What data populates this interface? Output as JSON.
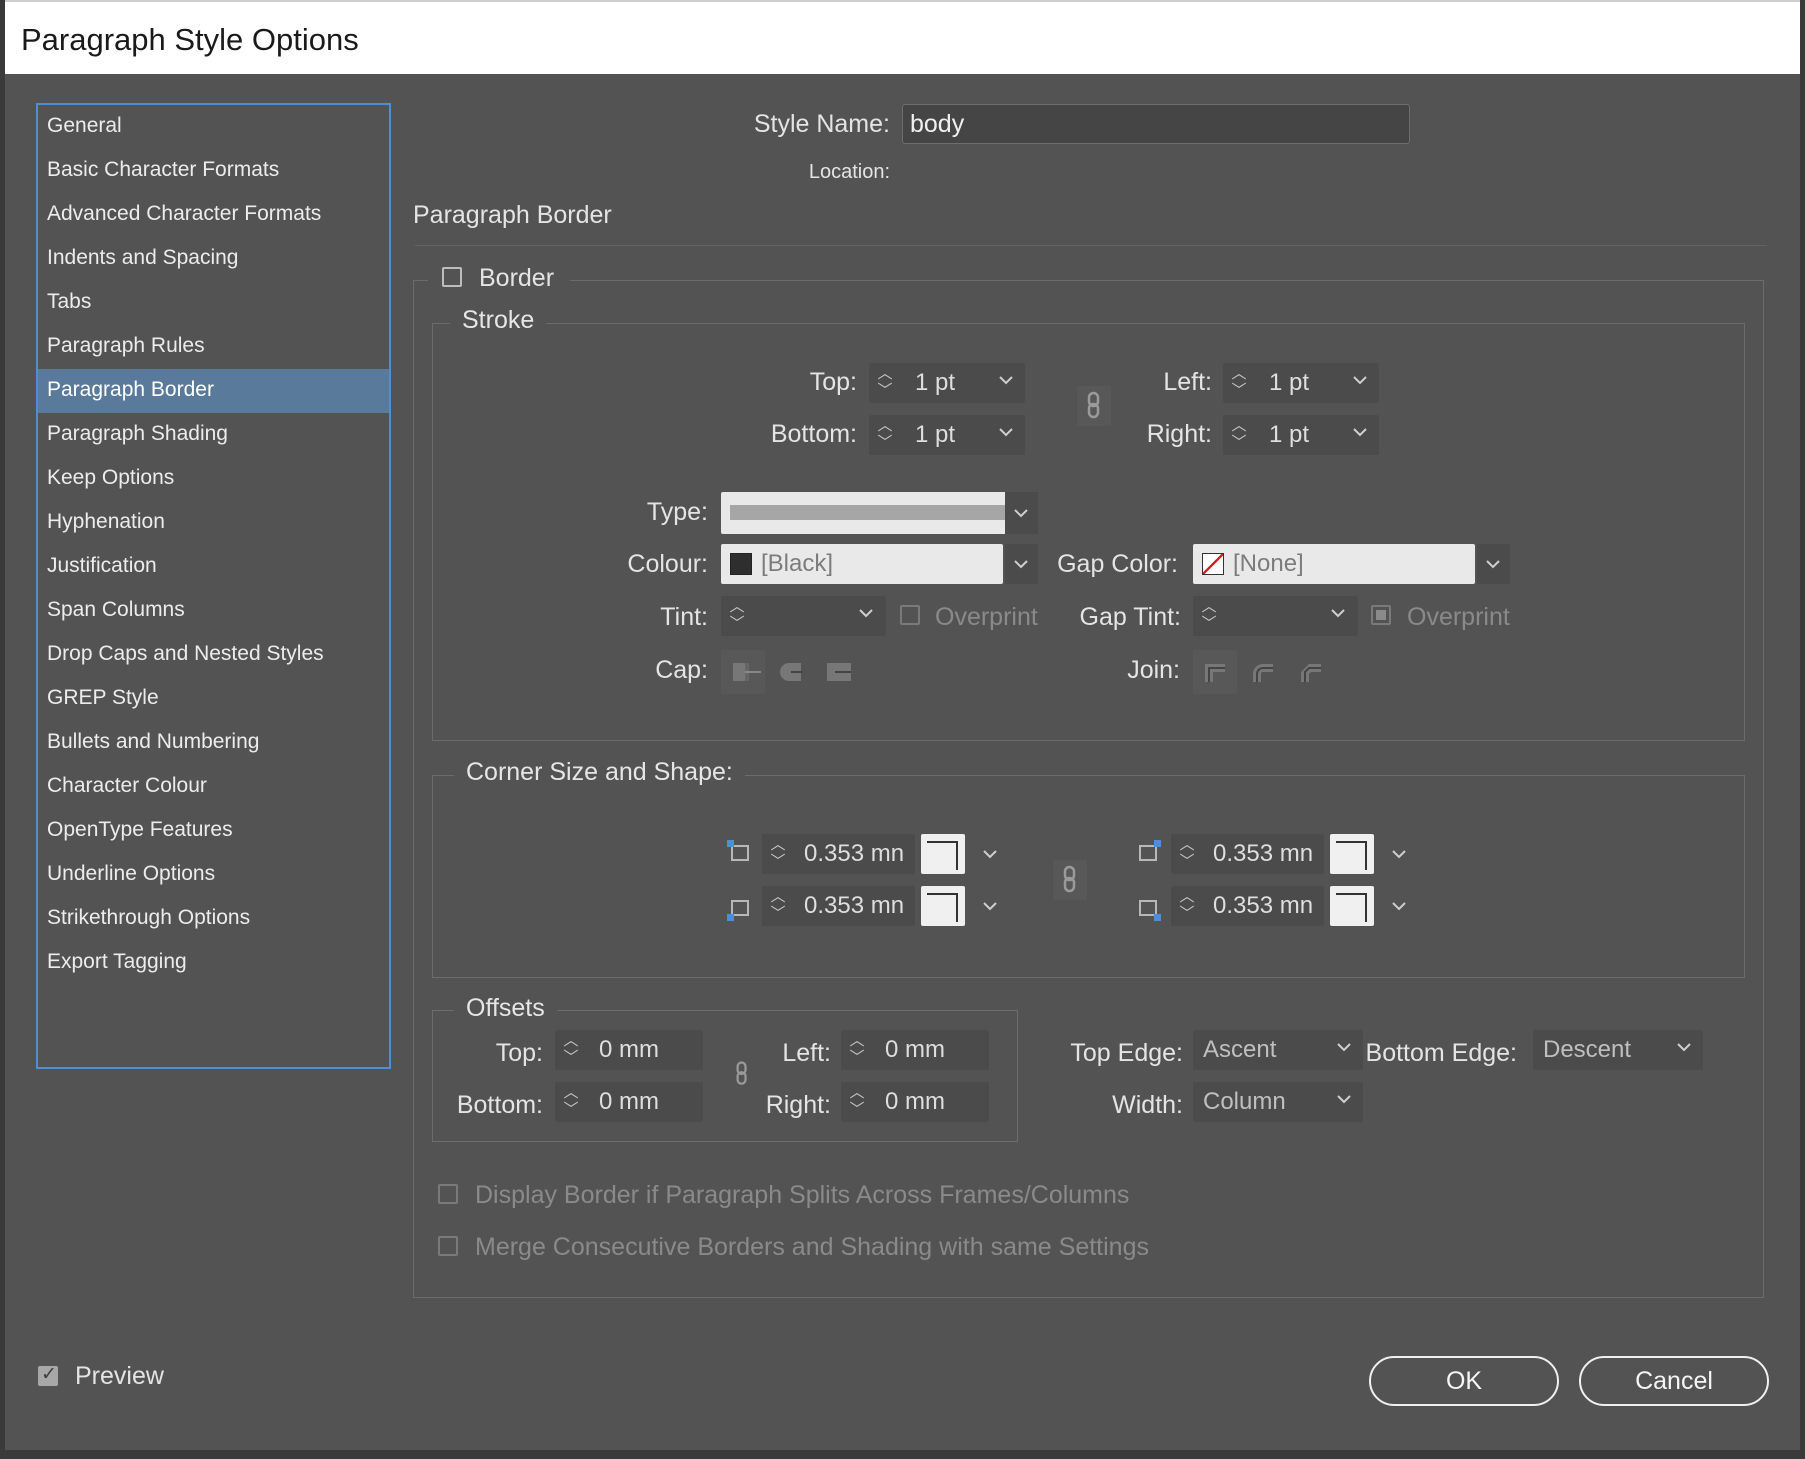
{
  "window": {
    "title": "Paragraph Style Options"
  },
  "sidebar": {
    "items": [
      {
        "label": "General"
      },
      {
        "label": "Basic Character Formats"
      },
      {
        "label": "Advanced Character Formats"
      },
      {
        "label": "Indents and Spacing"
      },
      {
        "label": "Tabs"
      },
      {
        "label": "Paragraph Rules"
      },
      {
        "label": "Paragraph Border",
        "selected": true
      },
      {
        "label": "Paragraph Shading"
      },
      {
        "label": "Keep Options"
      },
      {
        "label": "Hyphenation"
      },
      {
        "label": "Justification"
      },
      {
        "label": "Span Columns"
      },
      {
        "label": "Drop Caps and Nested Styles"
      },
      {
        "label": "GREP Style"
      },
      {
        "label": "Bullets and Numbering"
      },
      {
        "label": "Character Colour"
      },
      {
        "label": "OpenType Features"
      },
      {
        "label": "Underline Options"
      },
      {
        "label": "Strikethrough Options"
      },
      {
        "label": "Export Tagging"
      }
    ]
  },
  "header": {
    "style_name_label": "Style Name:",
    "style_name_value": "body",
    "location_label": "Location:",
    "section_title": "Paragraph Border"
  },
  "border": {
    "checkbox_label": "Border",
    "checked": false,
    "stroke": {
      "group_title": "Stroke",
      "top_label": "Top:",
      "top_value": "1 pt",
      "bottom_label": "Bottom:",
      "bottom_value": "1 pt",
      "left_label": "Left:",
      "left_value": "1 pt",
      "right_label": "Right:",
      "right_value": "1 pt",
      "type_label": "Type:",
      "colour_label": "Colour:",
      "colour_value": "[Black]",
      "gap_color_label": "Gap Color:",
      "gap_color_value": "[None]",
      "tint_label": "Tint:",
      "tint_value": "",
      "overprint_label": "Overprint",
      "gap_tint_label": "Gap Tint:",
      "gap_tint_value": "",
      "gap_overprint_label": "Overprint",
      "cap_label": "Cap:",
      "join_label": "Join:"
    },
    "corners": {
      "group_title": "Corner Size and Shape:",
      "top_left": "0.353 mn",
      "bottom_left": "0.353 mn",
      "top_right": "0.353 mn",
      "bottom_right": "0.353 mn"
    },
    "offsets": {
      "group_title": "Offsets",
      "top_label": "Top:",
      "top_value": "0 mm",
      "bottom_label": "Bottom:",
      "bottom_value": "0 mm",
      "left_label": "Left:",
      "left_value": "0 mm",
      "right_label": "Right:",
      "right_value": "0 mm"
    },
    "top_edge_label": "Top Edge:",
    "top_edge_value": "Ascent",
    "bottom_edge_label": "Bottom Edge:",
    "bottom_edge_value": "Descent",
    "width_label": "Width:",
    "width_value": "Column",
    "display_split_label": "Display Border if Paragraph Splits Across Frames/Columns",
    "merge_label": "Merge Consecutive Borders and Shading with same Settings"
  },
  "footer": {
    "preview_label": "Preview",
    "preview_checked": true,
    "ok_label": "OK",
    "cancel_label": "Cancel"
  },
  "colors": {
    "dialog_bg": "#535353",
    "selected_item": "#5a7a9c",
    "sidebar_border": "#4d8fd6"
  }
}
